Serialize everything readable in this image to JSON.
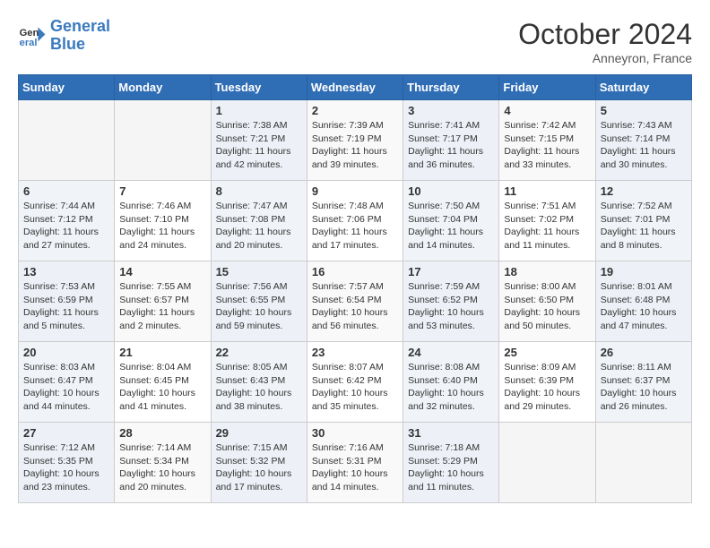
{
  "logo": {
    "line1": "General",
    "line2": "Blue"
  },
  "header": {
    "month": "October 2024",
    "location": "Anneyron, France"
  },
  "weekdays": [
    "Sunday",
    "Monday",
    "Tuesday",
    "Wednesday",
    "Thursday",
    "Friday",
    "Saturday"
  ],
  "weeks": [
    [
      {
        "day": "",
        "info": ""
      },
      {
        "day": "",
        "info": ""
      },
      {
        "day": "1",
        "info": "Sunrise: 7:38 AM\nSunset: 7:21 PM\nDaylight: 11 hours and 42 minutes."
      },
      {
        "day": "2",
        "info": "Sunrise: 7:39 AM\nSunset: 7:19 PM\nDaylight: 11 hours and 39 minutes."
      },
      {
        "day": "3",
        "info": "Sunrise: 7:41 AM\nSunset: 7:17 PM\nDaylight: 11 hours and 36 minutes."
      },
      {
        "day": "4",
        "info": "Sunrise: 7:42 AM\nSunset: 7:15 PM\nDaylight: 11 hours and 33 minutes."
      },
      {
        "day": "5",
        "info": "Sunrise: 7:43 AM\nSunset: 7:14 PM\nDaylight: 11 hours and 30 minutes."
      }
    ],
    [
      {
        "day": "6",
        "info": "Sunrise: 7:44 AM\nSunset: 7:12 PM\nDaylight: 11 hours and 27 minutes."
      },
      {
        "day": "7",
        "info": "Sunrise: 7:46 AM\nSunset: 7:10 PM\nDaylight: 11 hours and 24 minutes."
      },
      {
        "day": "8",
        "info": "Sunrise: 7:47 AM\nSunset: 7:08 PM\nDaylight: 11 hours and 20 minutes."
      },
      {
        "day": "9",
        "info": "Sunrise: 7:48 AM\nSunset: 7:06 PM\nDaylight: 11 hours and 17 minutes."
      },
      {
        "day": "10",
        "info": "Sunrise: 7:50 AM\nSunset: 7:04 PM\nDaylight: 11 hours and 14 minutes."
      },
      {
        "day": "11",
        "info": "Sunrise: 7:51 AM\nSunset: 7:02 PM\nDaylight: 11 hours and 11 minutes."
      },
      {
        "day": "12",
        "info": "Sunrise: 7:52 AM\nSunset: 7:01 PM\nDaylight: 11 hours and 8 minutes."
      }
    ],
    [
      {
        "day": "13",
        "info": "Sunrise: 7:53 AM\nSunset: 6:59 PM\nDaylight: 11 hours and 5 minutes."
      },
      {
        "day": "14",
        "info": "Sunrise: 7:55 AM\nSunset: 6:57 PM\nDaylight: 11 hours and 2 minutes."
      },
      {
        "day": "15",
        "info": "Sunrise: 7:56 AM\nSunset: 6:55 PM\nDaylight: 10 hours and 59 minutes."
      },
      {
        "day": "16",
        "info": "Sunrise: 7:57 AM\nSunset: 6:54 PM\nDaylight: 10 hours and 56 minutes."
      },
      {
        "day": "17",
        "info": "Sunrise: 7:59 AM\nSunset: 6:52 PM\nDaylight: 10 hours and 53 minutes."
      },
      {
        "day": "18",
        "info": "Sunrise: 8:00 AM\nSunset: 6:50 PM\nDaylight: 10 hours and 50 minutes."
      },
      {
        "day": "19",
        "info": "Sunrise: 8:01 AM\nSunset: 6:48 PM\nDaylight: 10 hours and 47 minutes."
      }
    ],
    [
      {
        "day": "20",
        "info": "Sunrise: 8:03 AM\nSunset: 6:47 PM\nDaylight: 10 hours and 44 minutes."
      },
      {
        "day": "21",
        "info": "Sunrise: 8:04 AM\nSunset: 6:45 PM\nDaylight: 10 hours and 41 minutes."
      },
      {
        "day": "22",
        "info": "Sunrise: 8:05 AM\nSunset: 6:43 PM\nDaylight: 10 hours and 38 minutes."
      },
      {
        "day": "23",
        "info": "Sunrise: 8:07 AM\nSunset: 6:42 PM\nDaylight: 10 hours and 35 minutes."
      },
      {
        "day": "24",
        "info": "Sunrise: 8:08 AM\nSunset: 6:40 PM\nDaylight: 10 hours and 32 minutes."
      },
      {
        "day": "25",
        "info": "Sunrise: 8:09 AM\nSunset: 6:39 PM\nDaylight: 10 hours and 29 minutes."
      },
      {
        "day": "26",
        "info": "Sunrise: 8:11 AM\nSunset: 6:37 PM\nDaylight: 10 hours and 26 minutes."
      }
    ],
    [
      {
        "day": "27",
        "info": "Sunrise: 7:12 AM\nSunset: 5:35 PM\nDaylight: 10 hours and 23 minutes."
      },
      {
        "day": "28",
        "info": "Sunrise: 7:14 AM\nSunset: 5:34 PM\nDaylight: 10 hours and 20 minutes."
      },
      {
        "day": "29",
        "info": "Sunrise: 7:15 AM\nSunset: 5:32 PM\nDaylight: 10 hours and 17 minutes."
      },
      {
        "day": "30",
        "info": "Sunrise: 7:16 AM\nSunset: 5:31 PM\nDaylight: 10 hours and 14 minutes."
      },
      {
        "day": "31",
        "info": "Sunrise: 7:18 AM\nSunset: 5:29 PM\nDaylight: 10 hours and 11 minutes."
      },
      {
        "day": "",
        "info": ""
      },
      {
        "day": "",
        "info": ""
      }
    ]
  ]
}
